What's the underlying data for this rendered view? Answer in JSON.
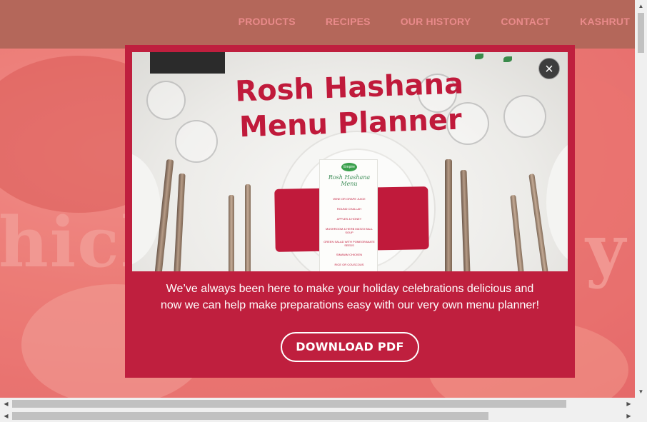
{
  "header": {
    "nav": [
      {
        "label": "PRODUCTS"
      },
      {
        "label": "RECIPES"
      },
      {
        "label": "OUR HISTORY"
      },
      {
        "label": "CONTACT"
      },
      {
        "label": "KASHRUT"
      }
    ]
  },
  "hero": {
    "title_fragment_left": "hick",
    "title_fragment_right": "y"
  },
  "popup": {
    "headline_line1": "Rosh Hashana",
    "headline_line2": "Menu Planner",
    "close_icon": "close-icon",
    "close_glyph": "×",
    "menu_card": {
      "logo": "Empire",
      "title_line1": "Rosh Hashana",
      "title_line2": "Menu",
      "items": [
        "WINE OR GRAPE JUICE",
        "ROUND CHALLAH",
        "APPLES & HONEY",
        "MUSHROOM & HERB MATZO BALL SOUP",
        "GREEN SALAD WITH POMEGRANATE SEEDS",
        "SIMANIM CHICKEN",
        "RICE OR COUSCOUS"
      ]
    },
    "body_line1": "We’ve always been here to make your holiday celebrations delicious and",
    "body_line2": "now we can help make preparations easy with our very own menu planner!",
    "download_label": "DOWNLOAD PDF"
  },
  "colors": {
    "header_bg": "#b4675a",
    "nav_text": "#e98a8a",
    "popup_bg": "#bf1f3e",
    "headline": "#c01a3b"
  }
}
